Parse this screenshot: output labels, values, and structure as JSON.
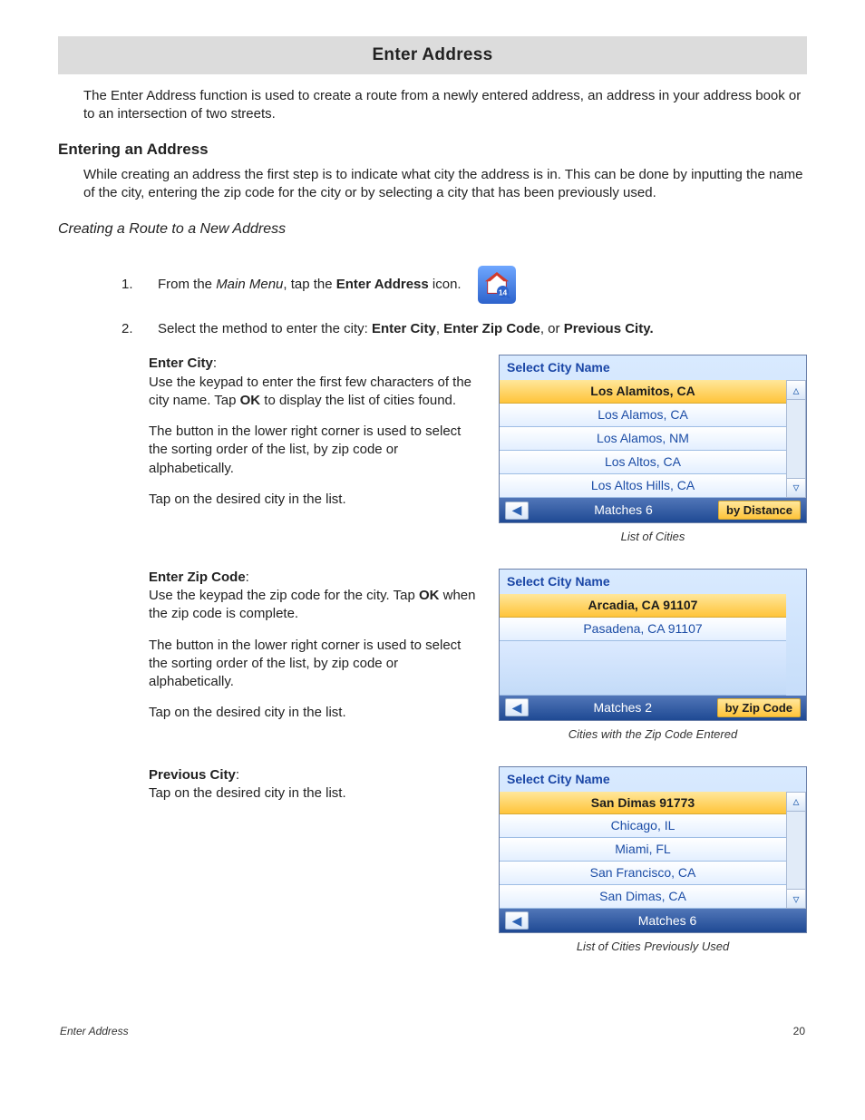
{
  "title": "Enter Address",
  "intro": "The Enter Address function is used to create a route from a newly entered address, an address in your address book or to an intersection of two streets.",
  "h2": "Entering an Address",
  "h2_para": "While creating an address the first step is to indicate what city the address is in.  This can be done by inputting the name of the city, entering the zip code for the city or by selecting a city that has been previously used.",
  "h3_italic": "Creating a Route to a New Address",
  "step1_num": "1.",
  "step1_a": "From the ",
  "step1_i": "Main Menu",
  "step1_b": ", tap the ",
  "step1_bold": "Enter Address",
  "step1_c": " icon.",
  "step2_num": "2.",
  "step2_a": "Select the method to enter the city: ",
  "step2_b1": "Enter City",
  "step2_sep1": ", ",
  "step2_b2": "Enter Zip Code",
  "step2_sep2": ", or ",
  "step2_b3": "Previous City.",
  "enter_city": {
    "heading": "Enter City",
    "colon": ":",
    "p1a": "Use the keypad to enter the first few characters of the city name.  Tap ",
    "p1b": "OK",
    "p1c": " to display the list of cities found.",
    "p2": "The button in the lower right corner is used to select the sorting order of the list, by zip code or alphabetically.",
    "p3": "Tap on the desired city in the list."
  },
  "enter_zip": {
    "heading": "Enter Zip Code",
    "colon": ":",
    "p1a": "Use the keypad the zip code for the city. Tap ",
    "p1b": "OK",
    "p1c": " when the zip code is complete.",
    "p2": "The button in the lower right corner is used to select the sorting order of the list, by zip code or alphabetically.",
    "p3": "Tap on the desired city in the list."
  },
  "prev_city": {
    "heading": "Previous City",
    "colon": ":",
    "p1": "Tap on the desired city in the list."
  },
  "device1": {
    "title": "Select City Name",
    "rows": [
      "Los Alamitos, CA",
      "Los Alamos, CA",
      "Los Alamos, NM",
      "Los Altos, CA",
      "Los Altos Hills, CA"
    ],
    "matches": "Matches  6",
    "sort": "by Distance",
    "caption": "List of Cities"
  },
  "device2": {
    "title": "Select City Name",
    "rows": [
      "Arcadia, CA 91107",
      "Pasadena, CA 91107"
    ],
    "matches": "Matches  2",
    "sort": "by Zip Code",
    "caption": "Cities with the Zip Code Entered"
  },
  "device3": {
    "title": "Select City Name",
    "rows": [
      "San Dimas 91773",
      "Chicago, IL",
      "Miami, FL",
      "San Francisco, CA",
      "San Dimas, CA"
    ],
    "matches": "Matches  6",
    "sort": "",
    "caption": "List of Cities Previously Used"
  },
  "footer_left": "Enter Address",
  "footer_right": "20"
}
